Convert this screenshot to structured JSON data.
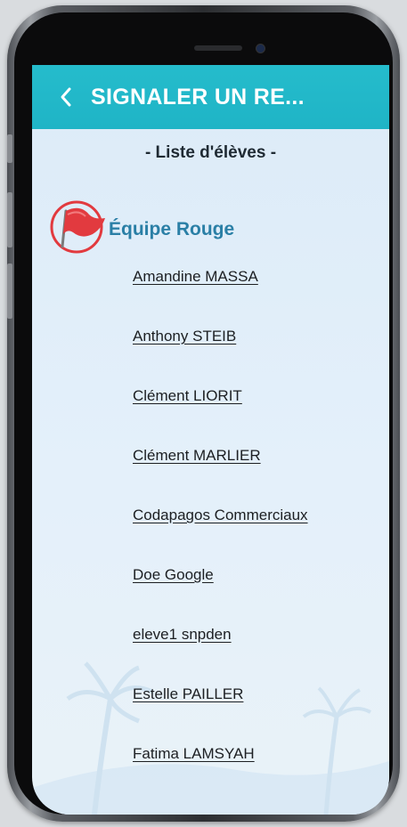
{
  "header": {
    "title": "SIGNALER UN RE..."
  },
  "list": {
    "subtitle": "- Liste d'élèves -"
  },
  "team": {
    "name": "Équipe Rouge",
    "icon": "red-flag-icon",
    "color": "#e23a3f"
  },
  "students": [
    "Amandine MASSA",
    "Anthony STEIB",
    "Clément LIORIT",
    "Clément MARLIER",
    "Codapagos Commerciaux",
    "Doe Google",
    "eleve1 snpden",
    "Estelle PAILLER",
    "Fatima LAMSYAH"
  ],
  "colors": {
    "appbar": "#1fb4c6",
    "team_text": "#2a7fa6"
  }
}
